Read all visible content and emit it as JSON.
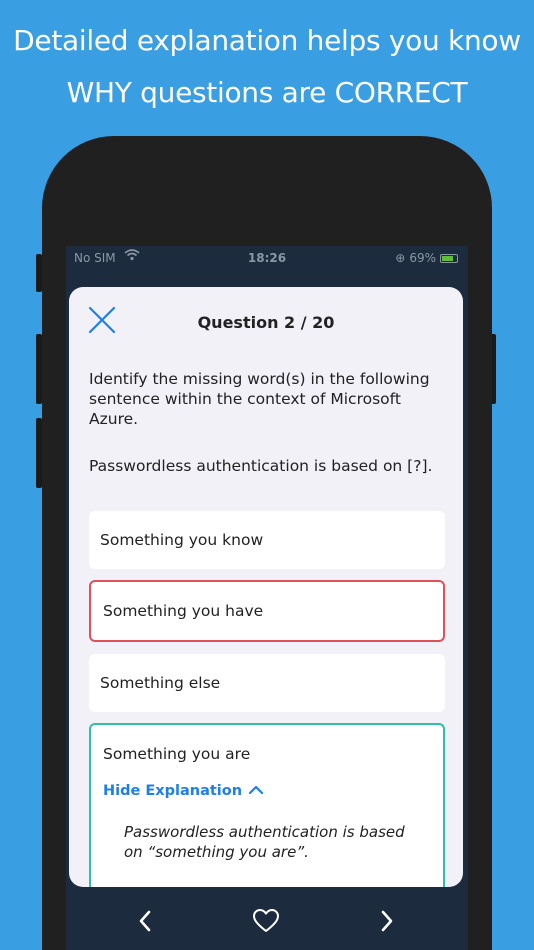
{
  "promo": {
    "line1": "Detailed explanation helps you know",
    "line2": "WHY questions are CORRECT"
  },
  "status_bar": {
    "carrier": "No SIM",
    "time": "18:26",
    "battery": "69%"
  },
  "quiz": {
    "title": "Question 2 / 20",
    "question": "Identify the missing word(s) in the following sentence within the context of Microsoft Azure.",
    "statement": "Passwordless authentication is based on [?].",
    "options": [
      {
        "label": "Something you know",
        "state": "neutral"
      },
      {
        "label": "Something you have",
        "state": "wrong"
      },
      {
        "label": "Something else",
        "state": "neutral"
      },
      {
        "label": "Something you are",
        "state": "correct"
      }
    ],
    "hide_explanation_label": "Hide Explanation",
    "explanation": "Passwordless authentication is based on “something you are”."
  },
  "colors": {
    "background": "#3a9ee2",
    "accent": "#1f7fe8",
    "wrong": "#e0525a",
    "correct": "#2fc0a6"
  },
  "icons": {
    "close": "close-icon",
    "chevron_up": "chevron-up-icon",
    "prev": "chevron-left-icon",
    "favorite": "heart-icon",
    "next": "chevron-right-icon"
  }
}
